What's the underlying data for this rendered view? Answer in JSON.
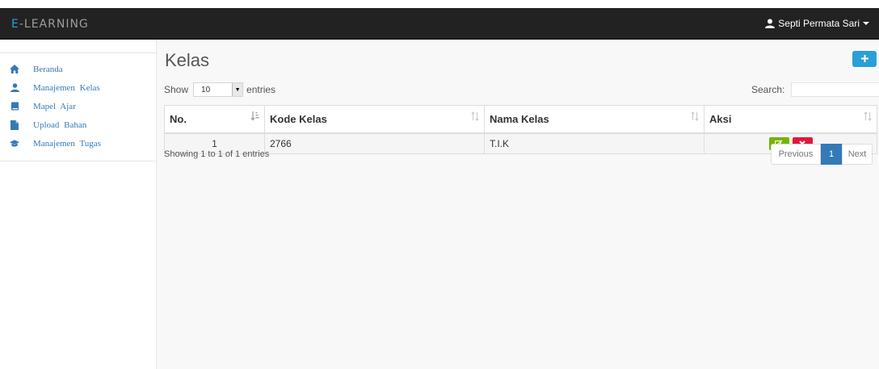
{
  "navbar": {
    "brand_initial": "E",
    "brand_rest": "-LEARNING",
    "user_name": "Septi Permata Sari"
  },
  "sidebar": {
    "items": [
      {
        "label": "Beranda",
        "icon": "home-icon"
      },
      {
        "label": "Manajemen Kelas",
        "icon": "user-icon"
      },
      {
        "label": "Mapel Ajar",
        "icon": "book-icon"
      },
      {
        "label": "Upload Bahan",
        "icon": "file-icon"
      },
      {
        "label": "Manajemen Tugas",
        "icon": "graduation-cap-icon"
      }
    ]
  },
  "main": {
    "title": "Kelas",
    "add_icon": "plus-icon",
    "length": {
      "prefix": "Show",
      "value": "10",
      "suffix": "entries"
    },
    "search": {
      "label": "Search:",
      "value": ""
    },
    "table": {
      "headers": [
        "No.",
        "Kode Kelas",
        "Nama Kelas",
        "Aksi"
      ],
      "rows": [
        {
          "no": "1",
          "kode": "2766",
          "nama": "T.I.K",
          "actions": [
            "edit-icon",
            "delete-icon"
          ]
        }
      ]
    },
    "info": "Showing 1 to 1 of 1 entries",
    "pagination": {
      "previous": "Previous",
      "current": "1",
      "next": "Next"
    }
  },
  "colors": {
    "navbar_bg": "#222222",
    "brand_accent": "#2a9fd6",
    "link": "#337ab7",
    "edit_button": "#77b300",
    "delete_button": "#e0163c",
    "add_button": "#2a9fd6"
  }
}
